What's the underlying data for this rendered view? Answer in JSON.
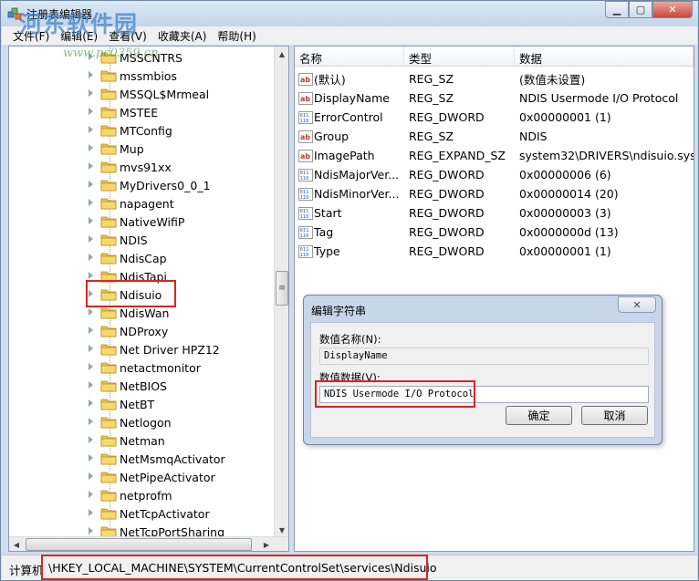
{
  "window": {
    "title": "注册表编辑器",
    "minimize_label": "▭",
    "maximize_label": "▢",
    "close_label": "✕"
  },
  "watermark": {
    "main": "河东软件园",
    "sub": "www.pc0359.cn"
  },
  "menu": [
    "文件(F)",
    "编辑(E)",
    "查看(V)",
    "收藏夹(A)",
    "帮助(H)"
  ],
  "tree": {
    "items": [
      "MSSCNTRS",
      "mssmbios",
      "MSSQL$Mrmeal",
      "MSTEE",
      "MTConfig",
      "Mup",
      "mvs91xx",
      "MyDrivers0_0_1",
      "napagent",
      "NativeWifiP",
      "NDIS",
      "NdisCap",
      "NdisTapi",
      "Ndisuio",
      "NdisWan",
      "NDProxy",
      "Net Driver HPZ12",
      "netactmonitor",
      "NetBIOS",
      "NetBT",
      "Netlogon",
      "Netman",
      "NetMsmqActivator",
      "NetPipeActivator",
      "netprofm",
      "NetTcpActivator",
      "NetTcpPortSharing"
    ],
    "selected": "Ndisuio"
  },
  "list": {
    "headers": {
      "name": "名称",
      "type": "类型",
      "data": "数据"
    },
    "rows": [
      {
        "icon": "string-value-icon",
        "name": "(默认)",
        "type": "REG_SZ",
        "data": "(数值未设置)"
      },
      {
        "icon": "string-value-icon",
        "name": "DisplayName",
        "type": "REG_SZ",
        "data": "NDIS Usermode I/O Protocol"
      },
      {
        "icon": "binary-value-icon",
        "name": "ErrorControl",
        "type": "REG_DWORD",
        "data": "0x00000001 (1)"
      },
      {
        "icon": "string-value-icon",
        "name": "Group",
        "type": "REG_SZ",
        "data": "NDIS"
      },
      {
        "icon": "string-value-icon",
        "name": "ImagePath",
        "type": "REG_EXPAND_SZ",
        "data": "system32\\DRIVERS\\ndisuio.sys"
      },
      {
        "icon": "binary-value-icon",
        "name": "NdisMajorVer...",
        "type": "REG_DWORD",
        "data": "0x00000006 (6)"
      },
      {
        "icon": "binary-value-icon",
        "name": "NdisMinorVer...",
        "type": "REG_DWORD",
        "data": "0x00000014 (20)"
      },
      {
        "icon": "binary-value-icon",
        "name": "Start",
        "type": "REG_DWORD",
        "data": "0x00000003 (3)"
      },
      {
        "icon": "binary-value-icon",
        "name": "Tag",
        "type": "REG_DWORD",
        "data": "0x0000000d (13)"
      },
      {
        "icon": "binary-value-icon",
        "name": "Type",
        "type": "REG_DWORD",
        "data": "0x00000001 (1)"
      }
    ]
  },
  "dialog": {
    "title": "编辑字符串",
    "close_label": "✕",
    "name_label": "数值名称(N):",
    "name_value": "DisplayName",
    "data_label": "数值数据(V):",
    "data_value": "NDIS Usermode I/O Protocol",
    "ok_label": "确定",
    "cancel_label": "取消"
  },
  "status": {
    "prefix": "计算机",
    "path": "\\HKEY_LOCAL_MACHINE\\SYSTEM\\CurrentControlSet\\services\\Ndisuio"
  },
  "colors": {
    "highlight": "#e0231e",
    "folder": "#e8c34a",
    "string_icon": "#c0392b",
    "binary_icon": "#2f5fa8"
  }
}
